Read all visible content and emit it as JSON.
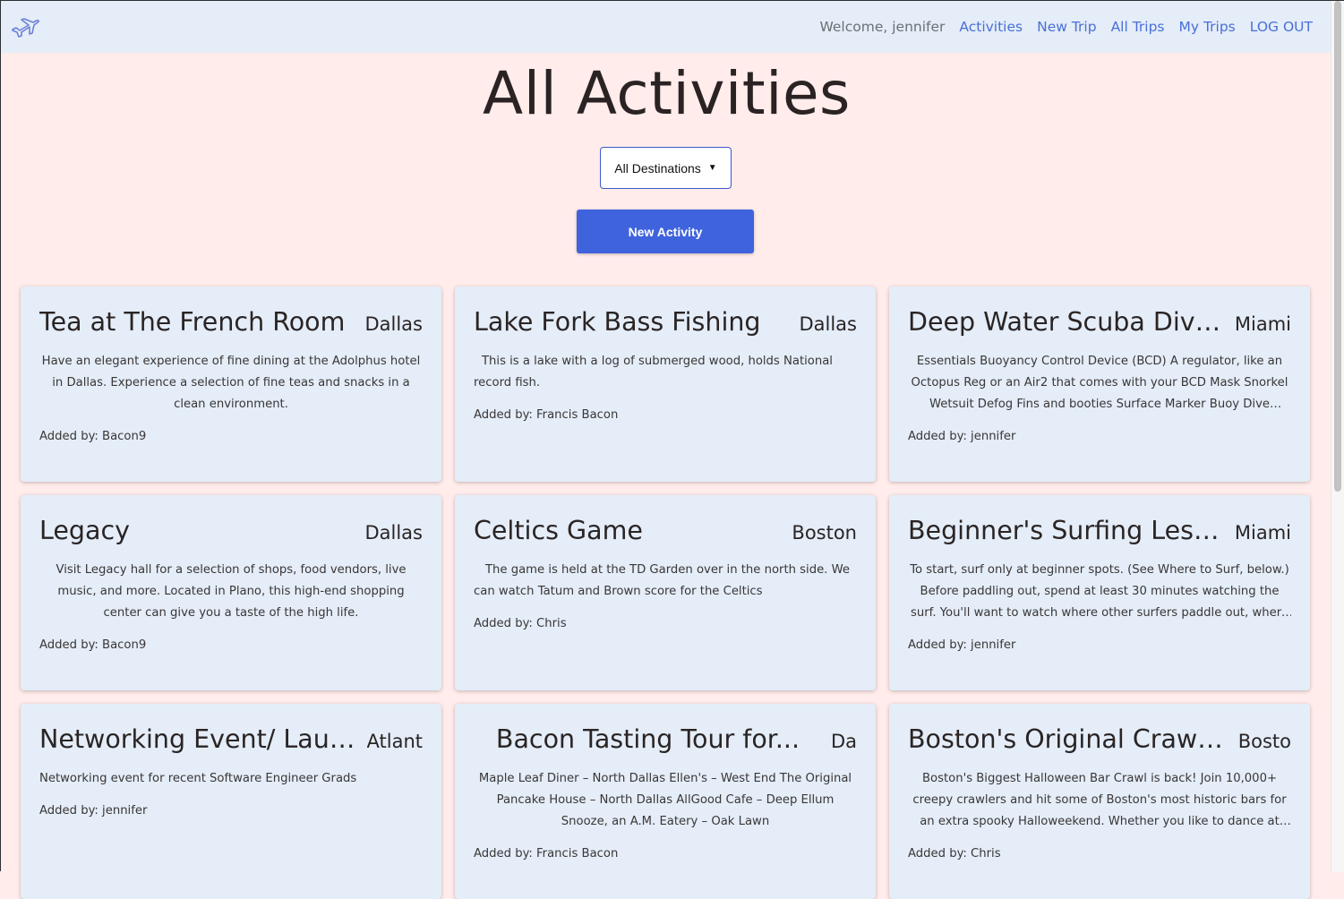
{
  "nav": {
    "welcome": "Welcome, jennifer",
    "links": [
      "Activities",
      "New Trip",
      "All Trips",
      "My Trips",
      "LOG OUT"
    ]
  },
  "page_title": "All Activities",
  "filter": {
    "selected": "All Destinations"
  },
  "new_activity_label": "New Activity",
  "cards": [
    {
      "title": "Tea at The French Room",
      "destination": "Dallas",
      "description": "Have an elegant experience of fine dining at the Adolphus hotel in Dallas. Experience a selection of fine teas and snacks in a clean environment.",
      "added_by": "Added by: Bacon9"
    },
    {
      "title": "Lake Fork Bass Fishing",
      "destination": "Dallas",
      "description": "This is a lake with a log of submerged wood, holds National record fish.",
      "added_by": "Added by: Francis Bacon"
    },
    {
      "title": "Deep Water Scuba Diving",
      "destination": "Miami",
      "description": "Essentials Buoyancy Control Device (BCD) A regulator, like an Octopus Reg or an Air2 that comes with your BCD Mask Snorkel Wetsuit Defog Fins and booties Surface Marker Buoy Dive weight, ...",
      "added_by": "Added by: jennifer"
    },
    {
      "title": "Legacy",
      "destination": "Dallas",
      "description": "Visit Legacy hall for a selection of shops, food vendors, live music, and more. Located in Plano, this high-end shopping center can give you a taste of the high life.",
      "added_by": "Added by: Bacon9"
    },
    {
      "title": "Celtics Game",
      "destination": "Boston",
      "description": "The game is held at the TD Garden over in the north side. We can watch Tatum and Brown score for the Celtics",
      "added_by": "Added by: Chris"
    },
    {
      "title": "Beginner's Surfing Lesson",
      "destination": "Miami",
      "description": "To start, surf only at beginner spots. (See Where to Surf, below.) Before paddling out, spend at least 30 minutes watching the surf. You'll want to watch where other surfers paddle out, where the...",
      "added_by": "Added by: jennifer"
    },
    {
      "title": "Networking Event/ Launc...",
      "destination": "Atlant",
      "description": "Networking event for recent Software Engineer Grads",
      "added_by": "Added by: jennifer"
    },
    {
      "title": "Bacon Tasting Tour for...",
      "destination": "Da",
      "description": "Maple Leaf Diner – North Dallas Ellen's – West End The Original Pancake House – North Dallas AllGood Cafe – Deep Ellum Snooze, an A.M. Eatery – Oak Lawn",
      "added_by": "Added by: Francis Bacon"
    },
    {
      "title": "Boston's Original Crawl-O-...",
      "destination": "Bosto",
      "description": "Boston's Biggest Halloween Bar Crawl is back! Join 10,000+ creepy crawlers and hit some of Boston's most historic bars for an extra spooky Halloweekend. Whether you like to dance at The Grand, or...",
      "added_by": "Added by: Chris"
    }
  ]
}
